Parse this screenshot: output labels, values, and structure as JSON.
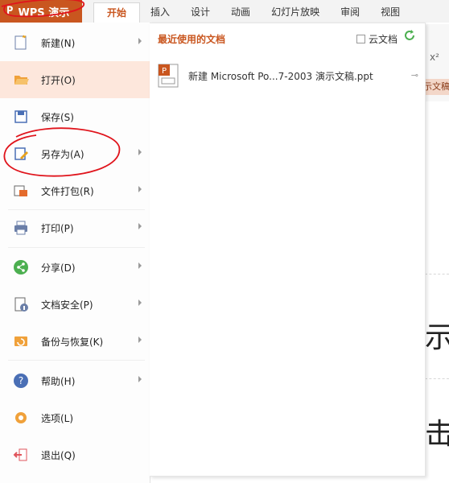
{
  "app": {
    "title": "WPS 演示",
    "logo": "P"
  },
  "tabs": [
    "开始",
    "插入",
    "设计",
    "动画",
    "幻灯片放映",
    "审阅",
    "视图"
  ],
  "active_tab": 0,
  "menu": {
    "items": [
      {
        "label": "新建(N)",
        "icon": "new-doc-icon",
        "has_arrow": true
      },
      {
        "label": "打开(O)",
        "icon": "folder-open-icon",
        "has_arrow": false,
        "active": true
      },
      {
        "label": "保存(S)",
        "icon": "save-icon",
        "has_arrow": false
      },
      {
        "label": "另存为(A)",
        "icon": "save-as-icon",
        "has_arrow": true
      },
      {
        "label": "文件打包(R)",
        "icon": "package-icon",
        "has_arrow": true
      },
      {
        "label": "打印(P)",
        "icon": "printer-icon",
        "has_arrow": true
      },
      {
        "label": "分享(D)",
        "icon": "share-icon",
        "has_arrow": true
      },
      {
        "label": "文档安全(P)",
        "icon": "doc-security-icon",
        "has_arrow": true
      },
      {
        "label": "备份与恢复(K)",
        "icon": "backup-icon",
        "has_arrow": true
      },
      {
        "label": "帮助(H)",
        "icon": "help-icon",
        "has_arrow": true
      },
      {
        "label": "选项(L)",
        "icon": "gear-icon",
        "has_arrow": false
      },
      {
        "label": "退出(Q)",
        "icon": "exit-icon",
        "has_arrow": false
      }
    ]
  },
  "recent": {
    "title": "最近使用的文档",
    "cloud_label": "云文档",
    "files": [
      {
        "name": "新建 Microsoft Po...7-2003 演示文稿.ppt"
      }
    ]
  },
  "background": {
    "ribbon_sup": "x²",
    "ribbon_tag": "示文稿",
    "doc_chars": [
      "示",
      "击"
    ]
  },
  "colors": {
    "accent": "#c9561f",
    "active_bg": "#fde7dc",
    "scribble": "#e0141c"
  }
}
